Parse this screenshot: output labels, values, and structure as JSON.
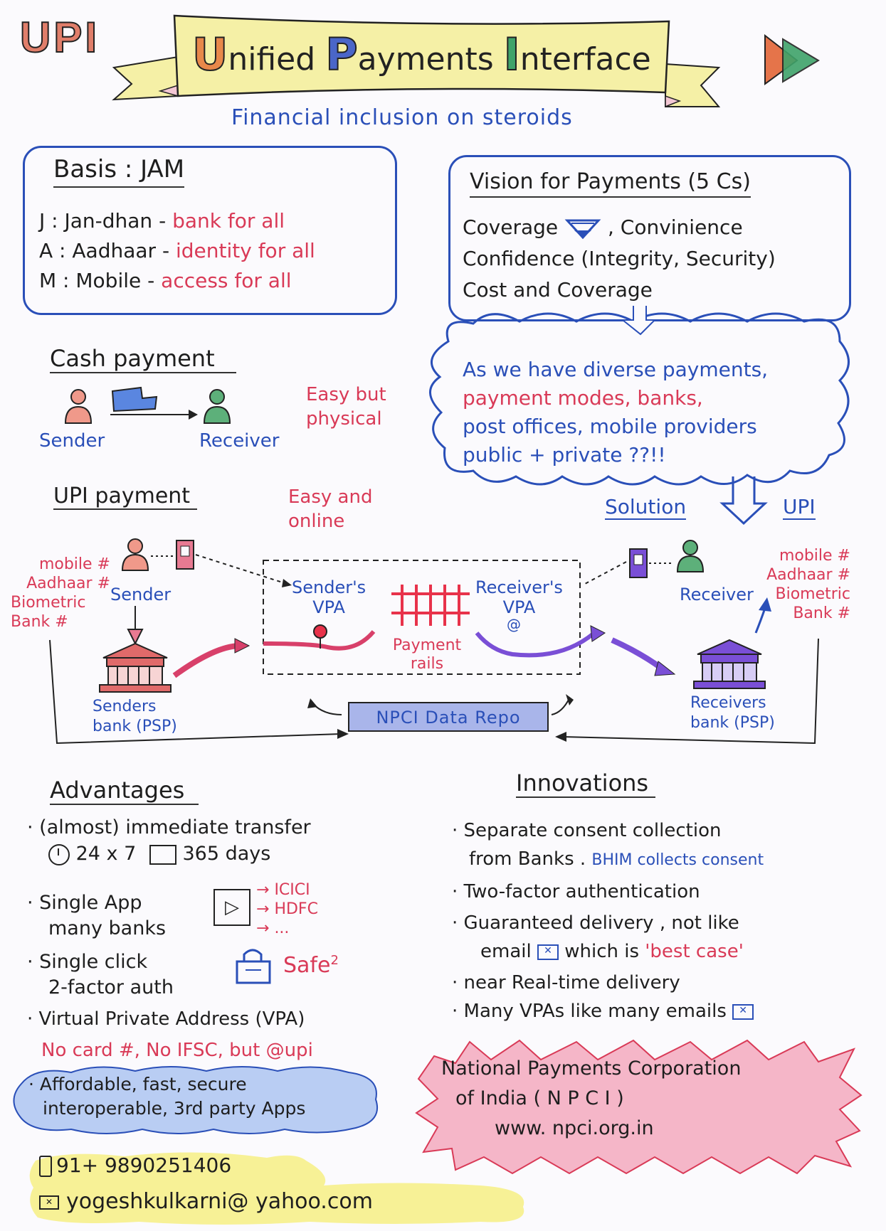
{
  "header": {
    "logo": "UPI",
    "title_letters": [
      "U",
      "P",
      "I"
    ],
    "title_rest": [
      "nified",
      "ayments",
      "nterface"
    ],
    "subtitle": "Financial inclusion on steroids"
  },
  "basis": {
    "title": "Basis : JAM",
    "rows": [
      {
        "label": "J : Jan-dhan -",
        "value": "bank for all"
      },
      {
        "label": "A : Aadhaar -",
        "value": "identity for all"
      },
      {
        "label": "M : Mobile -",
        "value": "access for all"
      }
    ]
  },
  "vision": {
    "title": "Vision for Payments (5 Cs)",
    "lines": [
      "Coverage",
      ", Convinience",
      "Confidence (Integrity, Security)",
      "Cost and Coverage"
    ]
  },
  "cloud": {
    "line1": "As we have diverse payments,",
    "line2": "payment modes, banks,",
    "line3": "post offices, mobile providers",
    "line4": "public + private ??!!",
    "solution": "Solution",
    "upi": "UPI"
  },
  "cash": {
    "title": "Cash payment",
    "sender": "Sender",
    "receiver": "Receiver",
    "note1": "Easy but",
    "note2": "physical"
  },
  "upi_payment": {
    "title": "UPI payment",
    "note1": "Easy and",
    "note2": "online",
    "sender_ids": [
      "mobile #",
      "Aadhaar #",
      "Biometric",
      "Bank #"
    ],
    "receiver_ids": [
      "mobile #",
      "Aadhaar #",
      "Biometric",
      "Bank #"
    ],
    "sender": "Sender",
    "receiver": "Receiver",
    "senders_vpa": [
      "Sender's",
      "VPA"
    ],
    "receivers_vpa": [
      "Receiver's",
      "VPA"
    ],
    "payment_rails": [
      "Payment",
      "rails"
    ],
    "senders_bank": [
      "Senders",
      "bank (PSP)"
    ],
    "receivers_bank": [
      "Receivers",
      "bank (PSP)"
    ],
    "npci_repo": "NPCI Data Repo"
  },
  "advantages": {
    "title": "Advantages",
    "transfer": "(almost) immediate transfer",
    "hours": "24 x 7",
    "days": "365 days",
    "single_app": [
      "Single App",
      "many banks"
    ],
    "banks": [
      "ICICI",
      "HDFC",
      "..."
    ],
    "single_click": [
      "Single click",
      "2-factor auth"
    ],
    "safe": "Safe",
    "safe_sup": "2",
    "vpa": "Virtual Private Address (VPA)",
    "vpa_note": "No card #, No IFSC, but @upi",
    "summary1": "Affordable, fast, secure",
    "summary2": "interoperable, 3rd party Apps"
  },
  "innovations": {
    "title": "Innovations",
    "i1a": "Separate consent collection",
    "i1b": "from Banks .",
    "i1c": "BHIM collects consent",
    "i2": "Two-factor authentication",
    "i3a": "Guaranteed delivery , not like",
    "i3b": "email",
    "i3c": "which is",
    "i3d": "'best case'",
    "i4": "near Real-time delivery",
    "i5": "Many VPAs like many emails"
  },
  "npci": {
    "line1": "National Payments Corporation",
    "line2": "of India ( N P C I )",
    "url": "www. npci.org.in"
  },
  "contact": {
    "phone": "91+ 9890251406",
    "email": "yogeshkulkarni@ yahoo.com"
  },
  "colors": {
    "blue_ink": "#2a4fb8",
    "red_ink": "#d93a57",
    "banner_yellow": "#f5f0a6",
    "banner_tail": "#f3c7d4",
    "npci_repo_fill": "#a9b5ea",
    "summary_fill": "#b9cdf3",
    "npci_fill": "#f5b6c8",
    "contact_fill": "#f7f196",
    "rails_red": "#e8324a",
    "flow_purple": "#7a4fd6"
  }
}
